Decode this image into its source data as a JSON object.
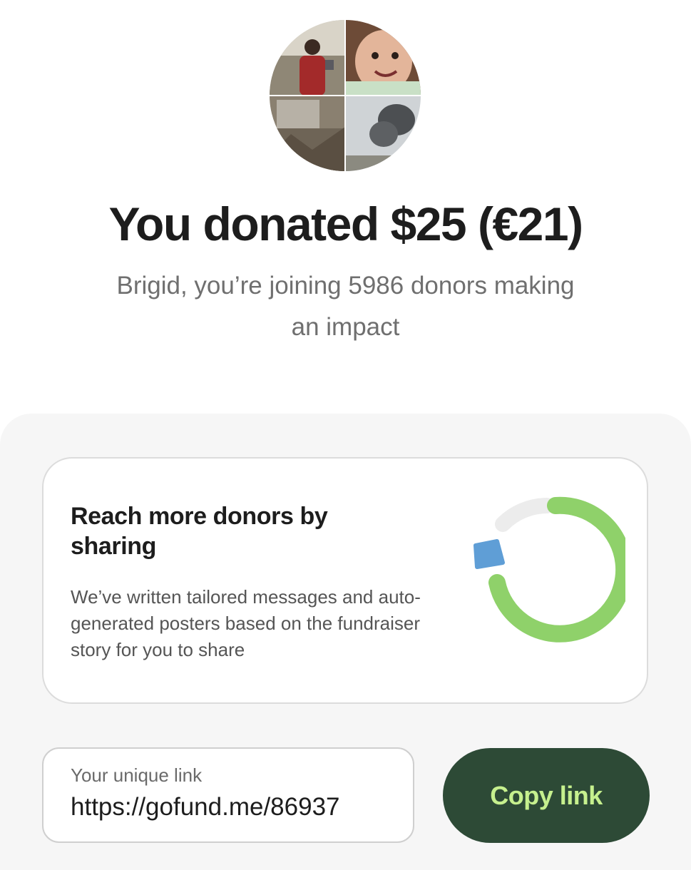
{
  "donation": {
    "headline": "You donated $25 (€21)",
    "subtitle": "Brigid, you’re joining 5986 donors making an impact"
  },
  "share_card": {
    "title": "Reach more donors by sharing",
    "description": "We’ve written tailored messages and auto-generated posters based on the fundraiser story for you to share"
  },
  "link": {
    "label": "Your unique link",
    "value": "https://gofund.me/86937"
  },
  "copy_button": {
    "label": "Copy link"
  },
  "colors": {
    "ring_green": "#8fd16a",
    "ring_blue": "#5f9ed6",
    "ring_track": "#ececec",
    "button_bg": "#2d4a36",
    "button_text": "#c6f08e"
  },
  "icons": {
    "avatar": "fundraiser-photo-collage",
    "progress": "donor-progress-ring"
  }
}
